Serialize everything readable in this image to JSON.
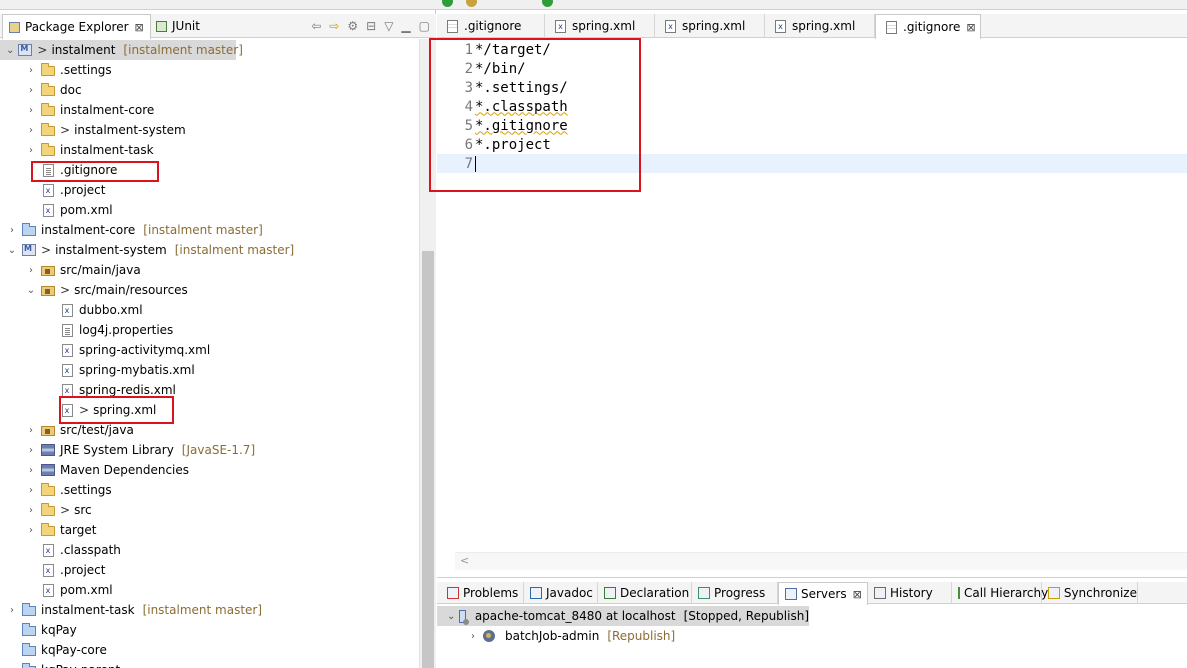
{
  "explorer": {
    "tabs": [
      {
        "label": "Package Explorer",
        "close": "⊠"
      },
      {
        "label": "JUnit"
      }
    ],
    "tree": [
      {
        "depth": 0,
        "chevron": "v",
        "icon": "project",
        "prefix": ">",
        "label": "instalment",
        "deco": "[instalment master]",
        "selected": true
      },
      {
        "depth": 1,
        "chevron": ">",
        "icon": "folder",
        "label": ".settings"
      },
      {
        "depth": 1,
        "chevron": ">",
        "icon": "folder",
        "label": "doc"
      },
      {
        "depth": 1,
        "chevron": ">",
        "icon": "folder",
        "label": "instalment-core"
      },
      {
        "depth": 1,
        "chevron": ">",
        "icon": "folder",
        "prefix": ">",
        "label": "instalment-system"
      },
      {
        "depth": 1,
        "chevron": ">",
        "icon": "folder",
        "label": "instalment-task"
      },
      {
        "depth": 1,
        "chevron": "",
        "icon": "file-txt",
        "label": ".gitignore"
      },
      {
        "depth": 1,
        "chevron": "",
        "icon": "file-x",
        "label": ".project"
      },
      {
        "depth": 1,
        "chevron": "",
        "icon": "file-x",
        "label": "pom.xml"
      },
      {
        "depth": 0,
        "chevron": ">",
        "icon": "closed",
        "label": "instalment-core",
        "deco": "[instalment master]"
      },
      {
        "depth": 0,
        "chevron": "v",
        "icon": "project",
        "prefix": ">",
        "label": "instalment-system",
        "deco": "[instalment master]"
      },
      {
        "depth": 1,
        "chevron": ">",
        "icon": "pkgfolder",
        "label": "src/main/java"
      },
      {
        "depth": 1,
        "chevron": "v",
        "icon": "pkgfolder",
        "prefix": ">",
        "label": "src/main/resources"
      },
      {
        "depth": 2,
        "chevron": "",
        "icon": "file-x",
        "label": "dubbo.xml"
      },
      {
        "depth": 2,
        "chevron": "",
        "icon": "file-txt",
        "label": "log4j.properties"
      },
      {
        "depth": 2,
        "chevron": "",
        "icon": "file-x",
        "label": "spring-activitymq.xml"
      },
      {
        "depth": 2,
        "chevron": "",
        "icon": "file-x",
        "label": "spring-mybatis.xml"
      },
      {
        "depth": 2,
        "chevron": "",
        "icon": "file-x",
        "label": "spring-redis.xml"
      },
      {
        "depth": 2,
        "chevron": "",
        "icon": "file-x",
        "prefix": ">",
        "label": "spring.xml"
      },
      {
        "depth": 1,
        "chevron": ">",
        "icon": "pkgfolder",
        "label": "src/test/java"
      },
      {
        "depth": 1,
        "chevron": ">",
        "icon": "lib",
        "label": "JRE System Library",
        "deco": "[JavaSE-1.7]"
      },
      {
        "depth": 1,
        "chevron": ">",
        "icon": "lib",
        "label": "Maven Dependencies"
      },
      {
        "depth": 1,
        "chevron": ">",
        "icon": "folder",
        "label": ".settings"
      },
      {
        "depth": 1,
        "chevron": ">",
        "icon": "folder",
        "prefix": ">",
        "label": "src"
      },
      {
        "depth": 1,
        "chevron": ">",
        "icon": "folder",
        "label": "target"
      },
      {
        "depth": 1,
        "chevron": "",
        "icon": "file-x",
        "label": ".classpath"
      },
      {
        "depth": 1,
        "chevron": "",
        "icon": "file-x",
        "label": ".project"
      },
      {
        "depth": 1,
        "chevron": "",
        "icon": "file-x",
        "label": "pom.xml"
      },
      {
        "depth": 0,
        "chevron": ">",
        "icon": "closed",
        "label": "instalment-task",
        "deco": "[instalment master]"
      },
      {
        "depth": 0,
        "chevron": "",
        "icon": "closed",
        "label": "kqPay"
      },
      {
        "depth": 0,
        "chevron": "",
        "icon": "closed",
        "label": "kqPay-core"
      },
      {
        "depth": 0,
        "chevron": "",
        "icon": "closed",
        "label": "kqPay-parent"
      }
    ]
  },
  "editor": {
    "tabs": [
      {
        "label": ".gitignore",
        "icon": "text"
      },
      {
        "label": "spring.xml",
        "icon": "xml"
      },
      {
        "label": "spring.xml",
        "icon": "xml"
      },
      {
        "label": "spring.xml",
        "icon": "xml"
      },
      {
        "label": ".gitignore",
        "icon": "text",
        "active": true,
        "close": "⊠"
      }
    ],
    "lines": [
      {
        "num": "1",
        "text": "*/target/"
      },
      {
        "num": "2",
        "text": "*/bin/"
      },
      {
        "num": "3",
        "text": "*.settings/"
      },
      {
        "num": "4",
        "text": "*.classpath",
        "squiggle": true
      },
      {
        "num": "5",
        "text": "*.gitignore",
        "squiggle": true
      },
      {
        "num": "6",
        "text": "*.project"
      },
      {
        "num": "7",
        "text": "",
        "current": true
      }
    ],
    "hscroll_arrow": "<"
  },
  "bottom": {
    "tabs": [
      {
        "label": "Problems"
      },
      {
        "label": "Javadoc"
      },
      {
        "label": "Declaration"
      },
      {
        "label": "Progress"
      },
      {
        "label": "Servers",
        "active": true,
        "close": "⊠"
      },
      {
        "label": "History"
      },
      {
        "label": "Call Hierarchy"
      },
      {
        "label": "Synchronize"
      }
    ],
    "servers": [
      {
        "chevron": "v",
        "label": "apache-tomcat_8480 at localhost",
        "status": "[Stopped, Republish]",
        "selected": true
      },
      {
        "chevron": ">",
        "label": "batchJob-admin",
        "status": "[Republish]"
      }
    ]
  },
  "colors": {
    "annotation_red": "#d9141e",
    "decoration_brown": "#8b6d35",
    "current_line": "#e8f2fe",
    "selection_gray": "#d9d9d9"
  }
}
